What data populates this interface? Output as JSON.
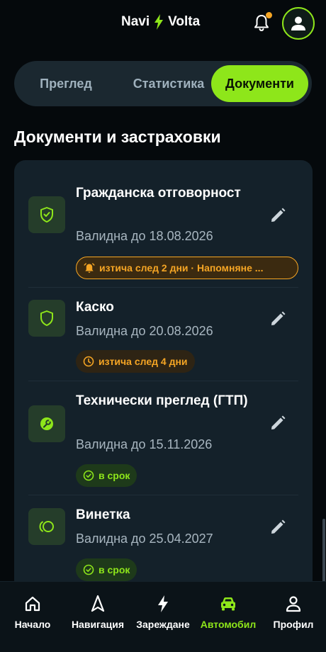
{
  "header": {
    "brand_left": "Navi",
    "brand_right": "Volta",
    "icons": [
      "bolt-icon",
      "bell-icon",
      "user-icon"
    ],
    "colors": {
      "accent": "#8ee61a",
      "notification": "#f5a524"
    }
  },
  "tabs": [
    {
      "label": "Преглед",
      "active": false
    },
    {
      "label": "Статистика",
      "active": false
    },
    {
      "label": "Документи",
      "active": true
    }
  ],
  "section_title": "Документи и застраховки",
  "documents": [
    {
      "title": "Гражданска отговорност",
      "valid": "Валидна до 18.08.2026",
      "icon": "shield-check-icon",
      "badge": "изтича след 2 дни · Напомняне ...",
      "badge_icon": "alarm-icon",
      "badge_status": "warning"
    },
    {
      "title": "Каско",
      "valid": "Валидна до 20.08.2026",
      "icon": "shield-icon",
      "badge": "изтича след 4 дни",
      "badge_icon": "clock-icon",
      "badge_status": "soon"
    },
    {
      "title": "Технически преглед (ГТП)",
      "valid": "Валидна до 15.11.2026",
      "icon": "wrench-icon",
      "badge": "в срок",
      "badge_icon": "check-circle-icon",
      "badge_status": "ok"
    },
    {
      "title": "Винетка",
      "valid": "Валидна до 25.04.2027",
      "icon": "vignette-icon",
      "badge": "в срок",
      "badge_icon": "check-circle-icon",
      "badge_status": "ok"
    }
  ],
  "bottom_nav": [
    {
      "label": "Начало",
      "icon": "home-icon",
      "active": false
    },
    {
      "label": "Навигация",
      "icon": "navigation-icon",
      "active": false
    },
    {
      "label": "Зареждане",
      "icon": "bolt-icon",
      "active": false
    },
    {
      "label": "Автомобил",
      "icon": "car-icon",
      "active": true
    },
    {
      "label": "Профил",
      "icon": "user-icon",
      "active": false
    }
  ]
}
